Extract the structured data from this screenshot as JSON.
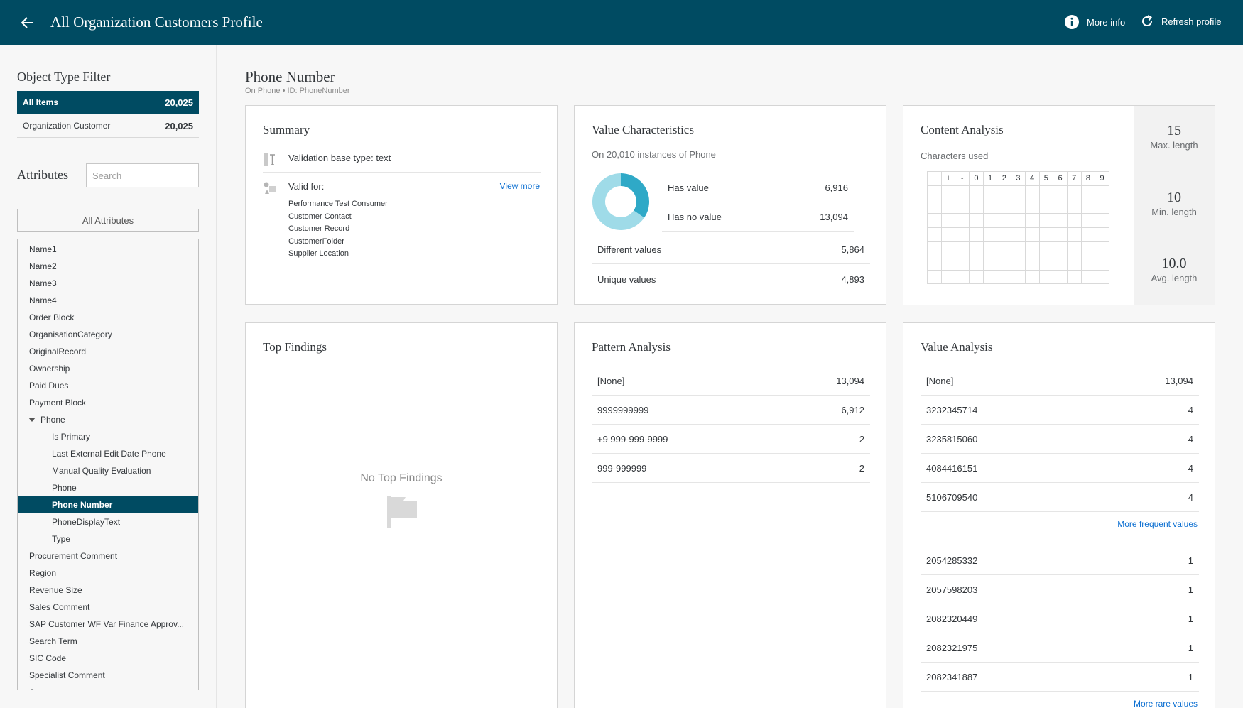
{
  "header": {
    "title": "All Organization Customers Profile",
    "more_info": "More info",
    "refresh": "Refresh profile",
    "bg_color": "#004b62"
  },
  "sidebar": {
    "filter_heading": "Object Type Filter",
    "filters": [
      {
        "label": "All Items",
        "count": "20,025",
        "selected": true
      },
      {
        "label": "Organization Customer",
        "count": "20,025",
        "selected": false
      }
    ],
    "attributes_heading": "Attributes",
    "search_placeholder": "Search",
    "all_attributes_label": "All Attributes",
    "attributes": [
      {
        "label": "Name1",
        "level": 0
      },
      {
        "label": "Name2",
        "level": 0
      },
      {
        "label": "Name3",
        "level": 0
      },
      {
        "label": "Name4",
        "level": 0
      },
      {
        "label": "Order Block",
        "level": 0
      },
      {
        "label": "OrganisationCategory",
        "level": 0
      },
      {
        "label": "OriginalRecord",
        "level": 0
      },
      {
        "label": "Ownership",
        "level": 0
      },
      {
        "label": "Paid Dues",
        "level": 0
      },
      {
        "label": "Payment Block",
        "level": 0
      },
      {
        "label": "Phone",
        "level": 0,
        "expanded": true
      },
      {
        "label": "Is Primary",
        "level": 1
      },
      {
        "label": "Last External Edit Date Phone",
        "level": 1
      },
      {
        "label": "Manual Quality Evaluation",
        "level": 1
      },
      {
        "label": "Phone",
        "level": 1
      },
      {
        "label": "Phone Number",
        "level": 1,
        "selected": true
      },
      {
        "label": "PhoneDisplayText",
        "level": 1
      },
      {
        "label": "Type",
        "level": 1
      },
      {
        "label": "Procurement Comment",
        "level": 0
      },
      {
        "label": "Region",
        "level": 0
      },
      {
        "label": "Revenue Size",
        "level": 0
      },
      {
        "label": "Sales Comment",
        "level": 0
      },
      {
        "label": "SAP Customer WF Var Finance Approv...",
        "level": 0
      },
      {
        "label": "Search Term",
        "level": 0
      },
      {
        "label": "SIC Code",
        "level": 0
      },
      {
        "label": "Specialist Comment",
        "level": 0
      },
      {
        "label": "Status",
        "level": 0
      }
    ]
  },
  "main": {
    "title": "Phone Number",
    "subtitle": "On Phone • ID: PhoneNumber"
  },
  "summary": {
    "title": "Summary",
    "validation": "Validation base type: text",
    "valid_for_label": "Valid for:",
    "view_more": "View more",
    "valid_for": [
      "Performance Test Consumer",
      "Customer Contact",
      "Customer Record",
      "CustomerFolder",
      "Supplier Location"
    ]
  },
  "value_characteristics": {
    "title": "Value Characteristics",
    "subtitle": "On 20,010 instances of Phone",
    "has_value_label": "Has value",
    "has_value": "6,916",
    "has_value_num": 6916,
    "has_no_value_label": "Has no value",
    "has_no_value": "13,094",
    "has_no_value_num": 13094,
    "different_label": "Different values",
    "different": "5,864",
    "unique_label": "Unique values",
    "unique": "4,893",
    "color_value": "#2fa9c7",
    "color_no_value": "#9fdbe8"
  },
  "content_analysis": {
    "title": "Content Analysis",
    "subtitle": "Characters used",
    "grid_header": [
      "",
      "+",
      "-",
      "0",
      "1",
      "2",
      "3",
      "4",
      "5",
      "6",
      "7",
      "8",
      "9"
    ],
    "max_length": "15",
    "max_label": "Max. length",
    "min_length": "10",
    "min_label": "Min. length",
    "avg_length": "10.0",
    "avg_label": "Avg. length"
  },
  "top_findings": {
    "title": "Top Findings",
    "empty_text": "No Top Findings"
  },
  "pattern_analysis": {
    "title": "Pattern Analysis",
    "rows": [
      {
        "pattern": "[None]",
        "count": "13,094"
      },
      {
        "pattern": "9999999999",
        "count": "6,912"
      },
      {
        "pattern": "+9 999-999-9999",
        "count": "2"
      },
      {
        "pattern": "999-999999",
        "count": "2"
      }
    ]
  },
  "value_analysis": {
    "title": "Value Analysis",
    "frequent": [
      {
        "value": "[None]",
        "count": "13,094"
      },
      {
        "value": "3232345714",
        "count": "4"
      },
      {
        "value": "3235815060",
        "count": "4"
      },
      {
        "value": "4084416151",
        "count": "4"
      },
      {
        "value": "5106709540",
        "count": "4"
      }
    ],
    "more_frequent": "More frequent values",
    "rare": [
      {
        "value": "2054285332",
        "count": "1"
      },
      {
        "value": "2057598203",
        "count": "1"
      },
      {
        "value": "2082320449",
        "count": "1"
      },
      {
        "value": "2082321975",
        "count": "1"
      },
      {
        "value": "2082341887",
        "count": "1"
      }
    ],
    "more_rare": "More rare values"
  }
}
